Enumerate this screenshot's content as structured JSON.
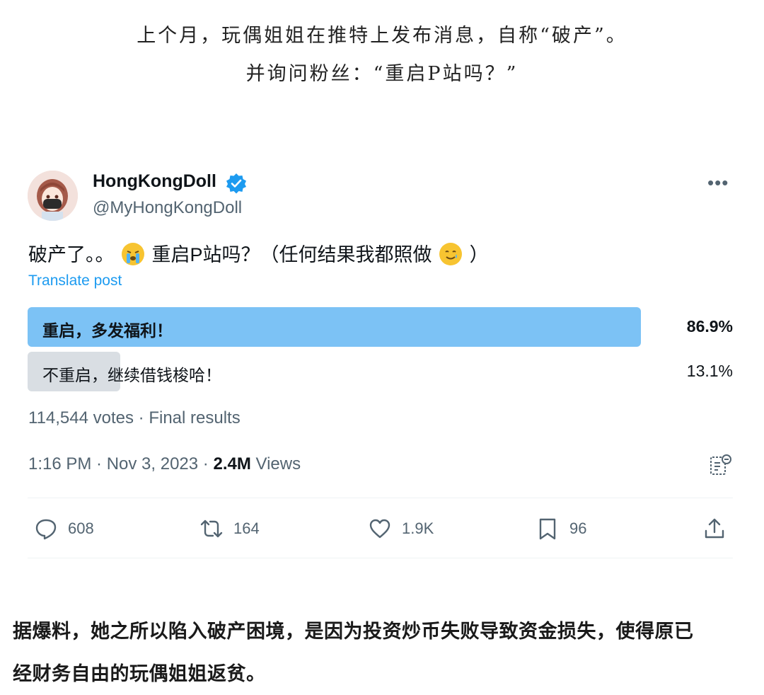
{
  "intro": {
    "line1": "上个月，玩偶姐姐在推特上发布消息，自称“破产”。",
    "line2": "并询问粉丝：“重启P站吗？”"
  },
  "tweet": {
    "display_name": "HongKongDoll",
    "handle": "@MyHongKongDoll",
    "text_part1": "破产了。。",
    "text_part2": "重启P站吗？（任何结果我都照做",
    "text_part3": "）",
    "translate_label": "Translate post",
    "poll": {
      "options": [
        {
          "label": "重启，多发福利！",
          "percent_label": "86.9%",
          "value": 86.9
        },
        {
          "label": "不重启，继续借钱梭哈！",
          "percent_label": "13.1%",
          "value": 13.1
        }
      ],
      "votes_text": "114,544 votes · Final results"
    },
    "meta": {
      "time": "1:16 PM · Nov 3, 2023 · ",
      "views_count": "2.4M",
      "views_label": " Views"
    },
    "actions": {
      "replies": "608",
      "reposts": "164",
      "likes": "1.9K",
      "bookmarks": "96"
    }
  },
  "footer": {
    "line1": "据爆料，她之所以陷入破产困境，是因为投资炒币失败导致资金损失，使得原已",
    "line2": "经财务自由的玩偶姐姐返贫。"
  },
  "icons": {
    "verified": "verified-badge-icon",
    "more": "more-icon",
    "emoji1": "crying-face-emoji",
    "emoji2": "tearful-smile-emoji",
    "analytics": "analytics-icon",
    "reply": "reply-icon",
    "repost": "repost-icon",
    "like": "heart-icon",
    "bookmark": "bookmark-icon",
    "share": "share-icon"
  },
  "colors": {
    "accent": "#1d9bf0",
    "poll_winner": "#7cc2f5",
    "poll_other": "#d9dee3",
    "secondary_text": "#536471"
  }
}
